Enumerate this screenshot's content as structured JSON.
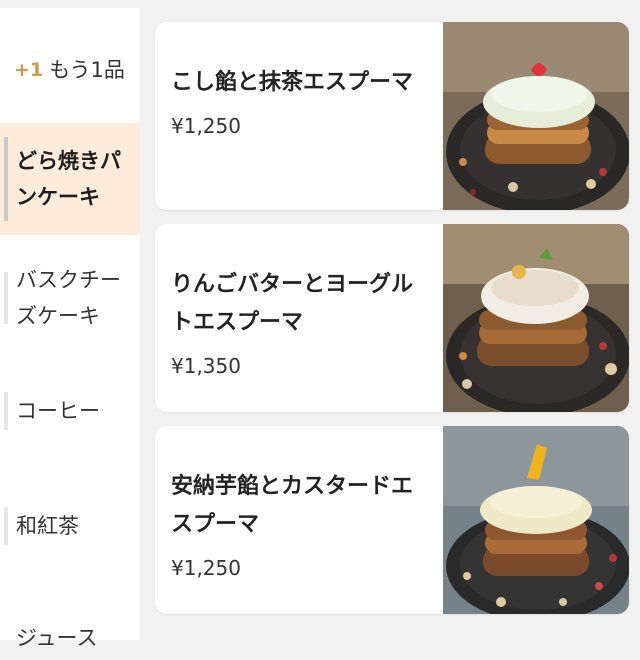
{
  "sidebar": {
    "items": [
      {
        "plus": "+1",
        "label": "もう1品"
      },
      {
        "label": "どら焼きパンケーキ",
        "active": true
      },
      {
        "label": "バスクチーズケーキ"
      },
      {
        "label": "コーヒー"
      },
      {
        "label": "和紅茶"
      },
      {
        "label": "ジュース"
      }
    ]
  },
  "menu": {
    "items": [
      {
        "name": "こし餡と抹茶エスプーマ",
        "price": "¥1,250",
        "photo": "matcha-pancake-photo"
      },
      {
        "name": "りんごバターとヨーグルトエスプーマ",
        "price": "¥1,350",
        "photo": "apple-pancake-photo"
      },
      {
        "name": "安納芋餡とカスタードエスプーマ",
        "price": "¥1,250",
        "photo": "sweetpotato-pancake-photo"
      }
    ]
  },
  "colors": {
    "accent": "#d19a4a",
    "active_bg": "#fdecd9",
    "page_bg": "#f1f1f1"
  }
}
